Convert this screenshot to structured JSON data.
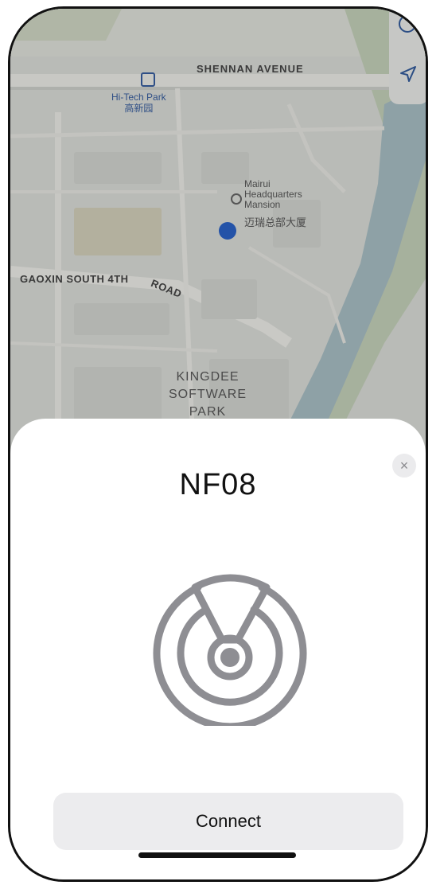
{
  "map": {
    "road_shennan": "SHENNAN AVENUE",
    "road_gaoxin_a": "GAOXIN SOUTH 4TH",
    "road_gaoxin_b": "ROAD",
    "metro_en": "Hi-Tech Park",
    "metro_cn": "高新园",
    "building_en_1": "Mairui",
    "building_en_2": "Headquarters",
    "building_en_3": "Mansion",
    "building_cn": "迈瑞总部大厦",
    "park_1": "KINGDEE",
    "park_2": "SOFTWARE",
    "park_3": "PARK",
    "icons": {
      "info": "info-icon",
      "locate": "location-arrow-icon",
      "metro": "metro-station-icon",
      "user_location": "user-location-dot"
    }
  },
  "sheet": {
    "close_glyph": "×",
    "device_name": "NF08",
    "device_icon": "radar-tracker-icon",
    "connect_label": "Connect"
  },
  "colors": {
    "accent_blue": "#2453a8",
    "sheet_bg": "#ffffff",
    "button_bg": "#ececee",
    "icon_gray": "#8e8e93"
  }
}
